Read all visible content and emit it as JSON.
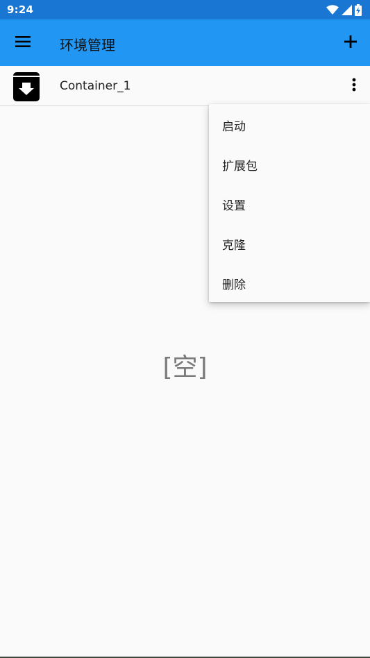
{
  "status_bar": {
    "time": "9:24",
    "icons": [
      "wifi-icon",
      "signal-icon",
      "battery-charging-icon"
    ]
  },
  "app_bar": {
    "title": "环境管理",
    "menu_icon": "hamburger-menu-icon",
    "add_icon": "plus-icon",
    "background_color": "#2196f3",
    "status_color": "#1976d2"
  },
  "containers": [
    {
      "name": "Container_1",
      "icon": "archive-download-icon"
    }
  ],
  "popup_menu": {
    "items": [
      {
        "label": "启动"
      },
      {
        "label": "扩展包"
      },
      {
        "label": "设置"
      },
      {
        "label": "克隆"
      },
      {
        "label": "删除"
      }
    ]
  },
  "empty_text": "[空]"
}
